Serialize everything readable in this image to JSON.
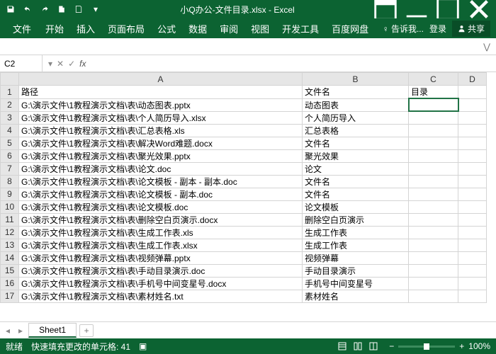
{
  "title": "小Q办公-文件目录.xlsx - Excel",
  "tabs": {
    "file": "文件",
    "home": "开始",
    "insert": "插入",
    "layout": "页面布局",
    "formulas": "公式",
    "data": "数据",
    "review": "审阅",
    "view": "视图",
    "dev": "开发工具",
    "baidu": "百度网盘",
    "tellme": "告诉我...",
    "login": "登录",
    "share": "共享"
  },
  "namebox": "C2",
  "headers": {
    "A": "路径",
    "B": "文件名",
    "C": "目录"
  },
  "rows": [
    {
      "a": "G:\\演示文件\\1教程演示文档\\表\\动态图表.pptx",
      "b": "动态图表"
    },
    {
      "a": "G:\\演示文件\\1教程演示文档\\表\\个人简历导入.xlsx",
      "b": "个人简历导入"
    },
    {
      "a": "G:\\演示文件\\1教程演示文档\\表\\汇总表格.xls",
      "b": "汇总表格"
    },
    {
      "a": "G:\\演示文件\\1教程演示文档\\表\\解决Word难题.docx",
      "b": "文件名"
    },
    {
      "a": "G:\\演示文件\\1教程演示文档\\表\\聚光效果.pptx",
      "b": "聚光效果"
    },
    {
      "a": "G:\\演示文件\\1教程演示文档\\表\\论文.doc",
      "b": "论文"
    },
    {
      "a": "G:\\演示文件\\1教程演示文档\\表\\论文模板 - 副本 - 副本.doc",
      "b": "文件名"
    },
    {
      "a": "G:\\演示文件\\1教程演示文档\\表\\论文模板 - 副本.doc",
      "b": "文件名"
    },
    {
      "a": "G:\\演示文件\\1教程演示文档\\表\\论文模板.doc",
      "b": "论文模板"
    },
    {
      "a": "G:\\演示文件\\1教程演示文档\\表\\删除空白页演示.docx",
      "b": "删除空白页演示"
    },
    {
      "a": "G:\\演示文件\\1教程演示文档\\表\\生成工作表.xls",
      "b": "生成工作表"
    },
    {
      "a": "G:\\演示文件\\1教程演示文档\\表\\生成工作表.xlsx",
      "b": "生成工作表"
    },
    {
      "a": "G:\\演示文件\\1教程演示文档\\表\\视频弹幕.pptx",
      "b": "视频弹幕"
    },
    {
      "a": "G:\\演示文件\\1教程演示文档\\表\\手动目录演示.doc",
      "b": "手动目录演示"
    },
    {
      "a": "G:\\演示文件\\1教程演示文档\\表\\手机号中间变星号.docx",
      "b": "手机号中间变星号"
    },
    {
      "a": "G:\\演示文件\\1教程演示文档\\表\\素材姓名.txt",
      "b": "素材姓名"
    }
  ],
  "sheet": "Sheet1",
  "status": {
    "ready": "就绪",
    "flash": "快速填充更改的单元格: 41",
    "zoom": "100%"
  }
}
